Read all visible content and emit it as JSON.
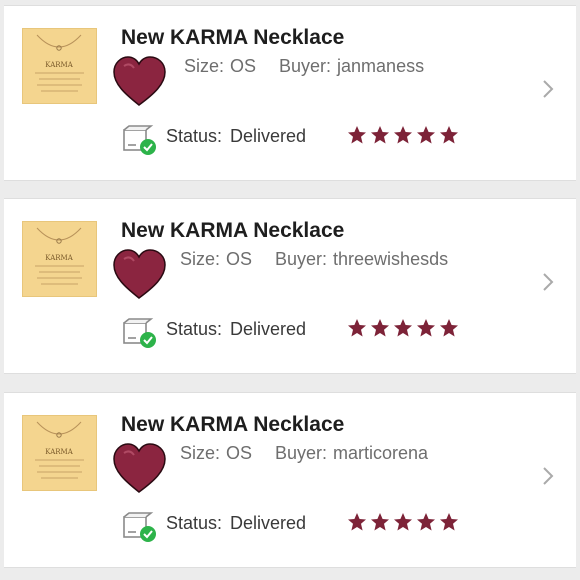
{
  "orders": [
    {
      "title": "New KARMA Necklace",
      "size_label": "Size:",
      "size_value": "OS",
      "buyer_label": "Buyer:",
      "buyer_value": "janmaness",
      "status_label": "Status:",
      "status_value": "Delivered",
      "rating": 5
    },
    {
      "title": "New KARMA Necklace",
      "size_label": "Size:",
      "size_value": "OS",
      "buyer_label": "Buyer:",
      "buyer_value": "threewishesds",
      "status_label": "Status:",
      "status_value": "Delivered",
      "rating": 5
    },
    {
      "title": "New KARMA Necklace",
      "size_label": "Size:",
      "size_value": "OS",
      "buyer_label": "Buyer:",
      "buyer_value": "marticorena",
      "status_label": "Status:",
      "status_value": "Delivered",
      "rating": 5
    }
  ],
  "thumbnail_text": "KARMA",
  "colors": {
    "heart": "#8b2540",
    "star": "#7d2338",
    "check": "#2db34a",
    "thumb_bg": "#f4d58f"
  },
  "icons": {
    "like": "heart-icon",
    "shipping": "package-delivered-icon",
    "rating": "star-icon",
    "navigate": "chevron-right-icon"
  }
}
